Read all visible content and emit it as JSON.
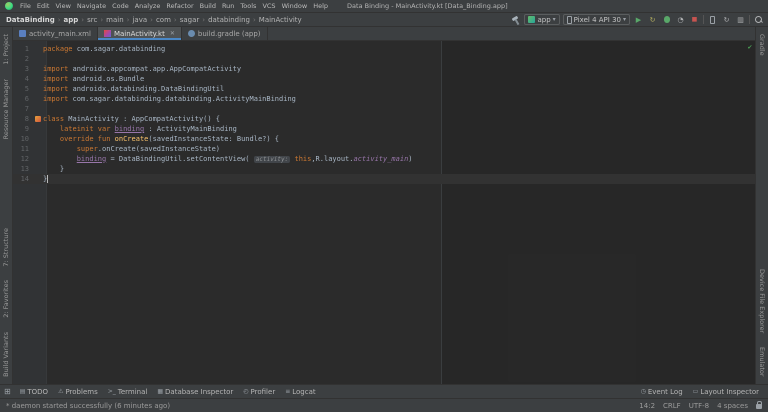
{
  "colors": {
    "bg_editor": "#2b2b2b",
    "bg_panel": "#3c3f41",
    "tab_underline": "#4a88c7",
    "keyword": "#cc7832",
    "code_text": "#a9b7c6",
    "function_name": "#ffc66d",
    "property": "#9876aa",
    "line_number": "#606366",
    "run_green": "#59a869",
    "stop_red": "#c75450",
    "ok_green": "#499c54"
  },
  "titlebar": {
    "menus": [
      "File",
      "Edit",
      "View",
      "Navigate",
      "Code",
      "Analyze",
      "Refactor",
      "Build",
      "Run",
      "Tools",
      "VCS",
      "Window",
      "Help"
    ],
    "title": "Data Binding - MainActivity.kt [Data_Binding.app]"
  },
  "toolbar": {
    "breadcrumb": [
      "DataBinding",
      "app",
      "src",
      "main",
      "java",
      "com",
      "sagar",
      "databinding",
      "MainActivity"
    ],
    "run_config": "app",
    "device": "Pixel 4 API 30"
  },
  "tabs": [
    {
      "label": "activity_main.xml",
      "icon": "layout-xml",
      "active": false
    },
    {
      "label": "MainActivity.kt",
      "icon": "kotlin",
      "active": true
    },
    {
      "label": "build.gradle (app)",
      "icon": "gradle",
      "active": false
    }
  ],
  "tool_strips": {
    "left_top": [
      "1: Project",
      "Resource Manager"
    ],
    "left_bottom": [
      "7: Structure",
      "2: Favorites",
      "Build Variants"
    ],
    "right_top": [
      "Gradle"
    ],
    "right_bottom": [
      "Device File Explorer",
      "Emulator"
    ]
  },
  "editor": {
    "lines": [
      {
        "n": 1,
        "seg": [
          [
            "k",
            "package"
          ],
          [
            "p",
            " com.sagar.databinding"
          ]
        ]
      },
      {
        "n": 2,
        "seg": []
      },
      {
        "n": 3,
        "seg": [
          [
            "k",
            "import"
          ],
          [
            "p",
            " androidx.appcompat.app.AppCompatActivity"
          ]
        ]
      },
      {
        "n": 4,
        "seg": [
          [
            "k",
            "import"
          ],
          [
            "p",
            " android.os.Bundle"
          ]
        ]
      },
      {
        "n": 5,
        "seg": [
          [
            "k",
            "import"
          ],
          [
            "p",
            " androidx.databinding.DataBindingUtil"
          ]
        ]
      },
      {
        "n": 6,
        "seg": [
          [
            "k",
            "import"
          ],
          [
            "p",
            " com.sagar.databinding.databinding.ActivityMainBinding"
          ]
        ]
      },
      {
        "n": 7,
        "seg": []
      },
      {
        "n": 8,
        "icon": true,
        "seg": [
          [
            "k",
            "class"
          ],
          [
            "p",
            " MainActivity : AppCompatActivity() {"
          ]
        ]
      },
      {
        "n": 9,
        "seg": [
          [
            "p",
            "    "
          ],
          [
            "k",
            "lateinit var"
          ],
          [
            "p",
            " "
          ],
          [
            "v",
            "binding"
          ],
          [
            "p",
            " : ActivityMainBinding"
          ]
        ]
      },
      {
        "n": 10,
        "seg": [
          [
            "p",
            "    "
          ],
          [
            "k",
            "override fun"
          ],
          [
            "p",
            " "
          ],
          [
            "f",
            "onCreate"
          ],
          [
            "p",
            "(savedInstanceState: Bundle?) {"
          ]
        ]
      },
      {
        "n": 11,
        "seg": [
          [
            "p",
            "        "
          ],
          [
            "k",
            "super"
          ],
          [
            "p",
            ".onCreate(savedInstanceState)"
          ]
        ]
      },
      {
        "n": 12,
        "seg": [
          [
            "p",
            "        "
          ],
          [
            "v",
            "binding"
          ],
          [
            "p",
            " = DataBindingUtil.setContentView( "
          ],
          [
            "h",
            "activity:"
          ],
          [
            "p",
            " "
          ],
          [
            "k",
            "this"
          ],
          [
            "p",
            ",R.layout."
          ],
          [
            "s",
            "activity_main"
          ],
          [
            "p",
            ")"
          ]
        ]
      },
      {
        "n": 13,
        "seg": [
          [
            "p",
            "    }"
          ]
        ]
      },
      {
        "n": 14,
        "current": true,
        "seg": [
          [
            "p",
            "}"
          ]
        ]
      }
    ]
  },
  "bottom_bar": {
    "left": [
      {
        "label": "TODO",
        "icon": "todo"
      },
      {
        "label": "Problems",
        "icon": "problems"
      },
      {
        "label": "Terminal",
        "icon": "terminal"
      },
      {
        "label": "Database Inspector",
        "icon": "database"
      },
      {
        "label": "Profiler",
        "icon": "profiler"
      },
      {
        "label": "Logcat",
        "icon": "logcat"
      }
    ],
    "right": [
      {
        "label": "Event Log",
        "icon": "event_log"
      },
      {
        "label": "Layout Inspector",
        "icon": "layout_inspector"
      }
    ]
  },
  "status_bar": {
    "message": "* daemon started successfully (6 minutes ago)",
    "caret_position": "14:2",
    "line_separator": "CRLF",
    "encoding": "UTF-8",
    "indent": "4 spaces"
  },
  "icons": {
    "dropdown_arrow": "▾",
    "run": "▶",
    "apply_changes": "↻",
    "profile": "◔",
    "stop": "■",
    "sync": "↻",
    "sdk_manager": "▥",
    "check": "✔",
    "close": "✕",
    "switcher": "⊞",
    "separator": "›",
    "todo": "▤",
    "problems": "⚠",
    "terminal": ">_",
    "database": "▦",
    "profiler": "◴",
    "logcat": "≡",
    "event_log": "◷",
    "layout_inspector": "▭"
  }
}
